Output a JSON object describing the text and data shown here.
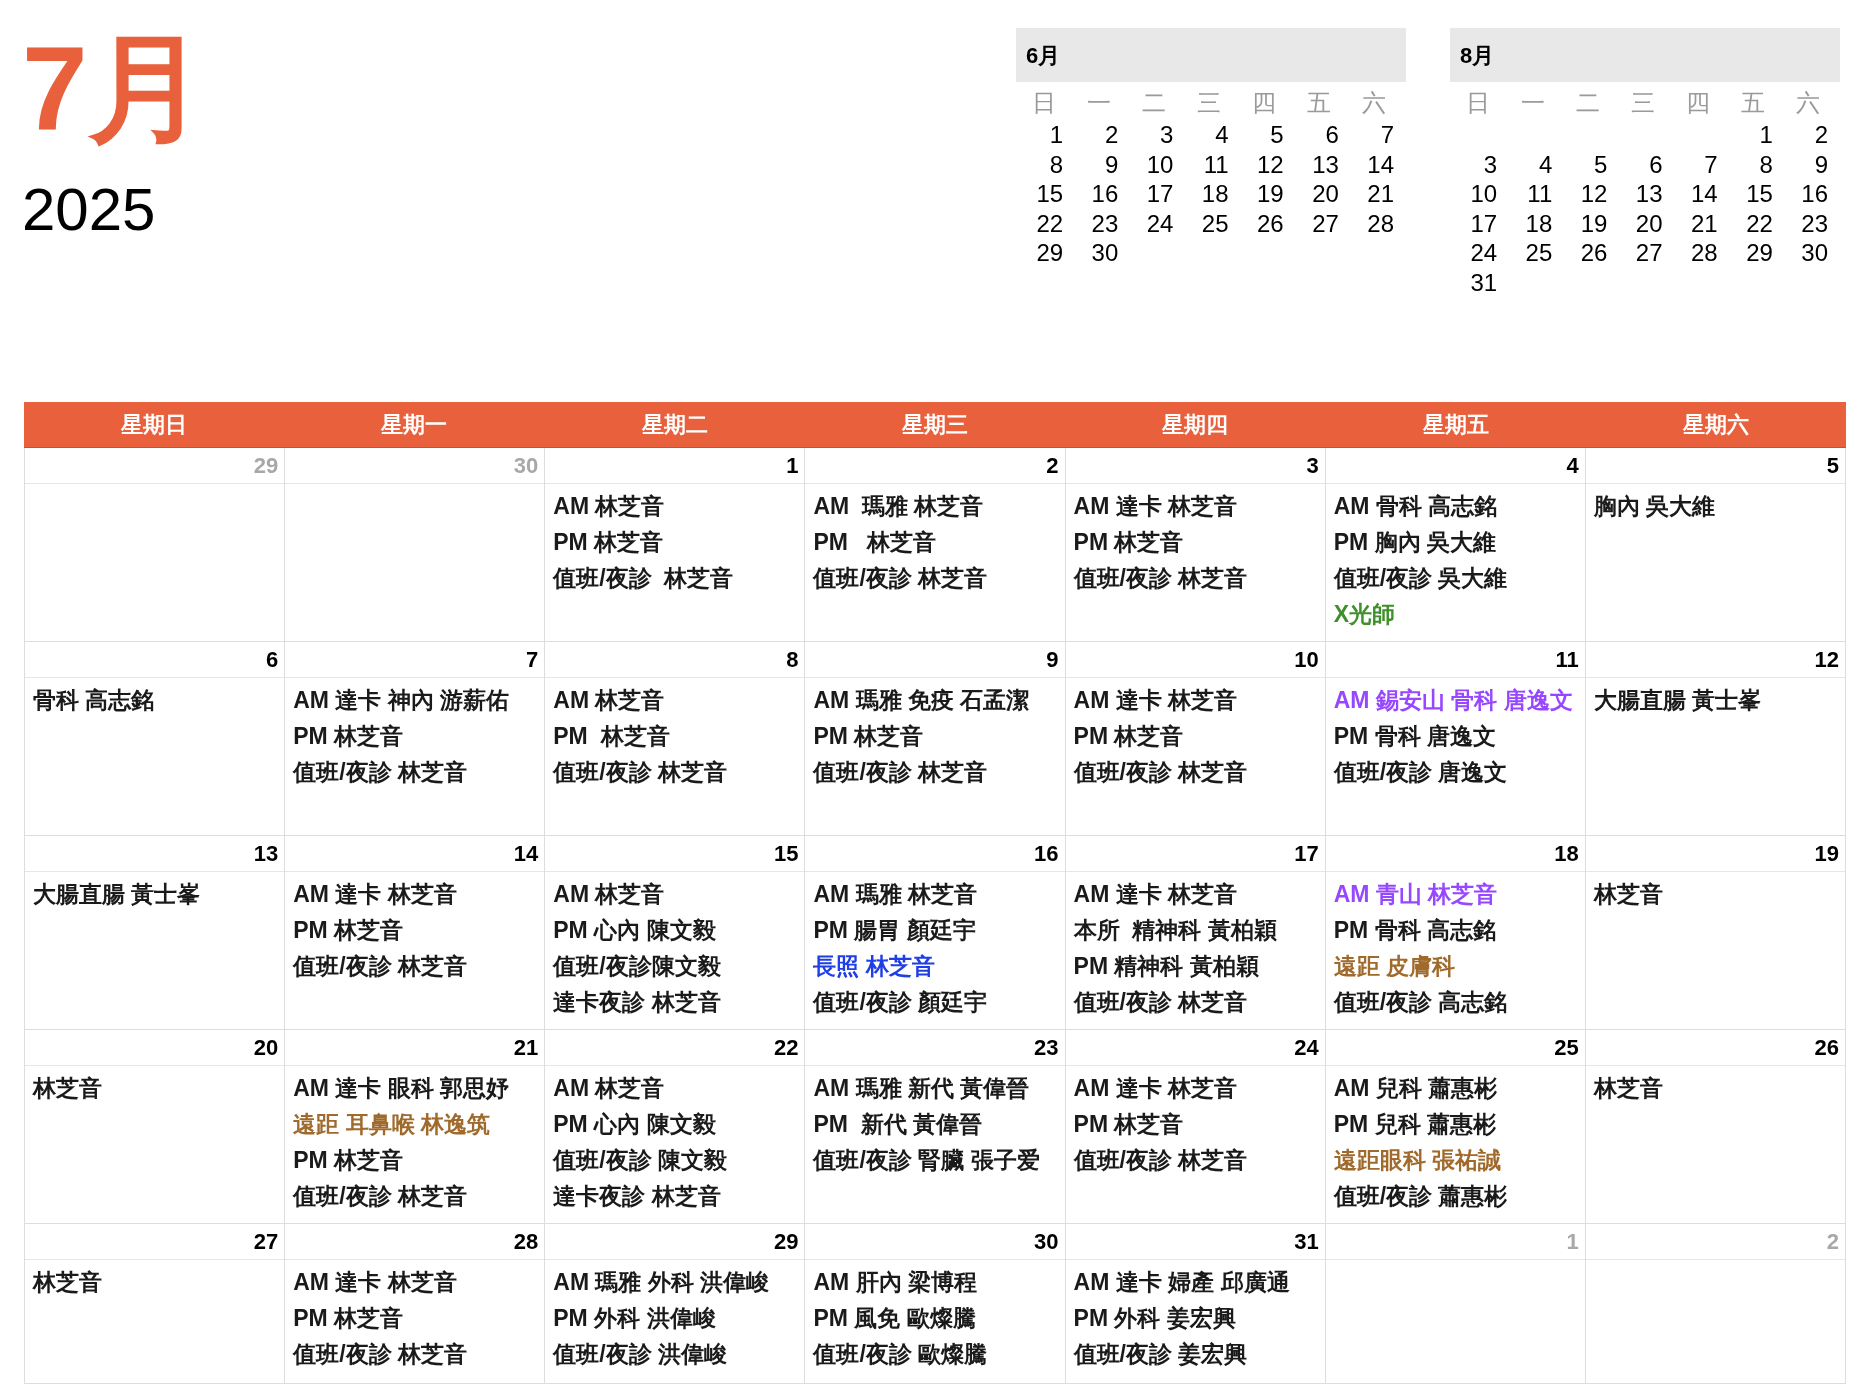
{
  "title": {
    "month": "7月",
    "year": "2025"
  },
  "mini_calendars": [
    {
      "title": "6月",
      "weekdays": [
        "日",
        "一",
        "二",
        "三",
        "四",
        "五",
        "六"
      ],
      "weeks": [
        [
          "1",
          "2",
          "3",
          "4",
          "5",
          "6",
          "7"
        ],
        [
          "8",
          "9",
          "10",
          "11",
          "12",
          "13",
          "14"
        ],
        [
          "15",
          "16",
          "17",
          "18",
          "19",
          "20",
          "21"
        ],
        [
          "22",
          "23",
          "24",
          "25",
          "26",
          "27",
          "28"
        ],
        {
          "right_aligned": false,
          "days": [
            "29",
            "30"
          ]
        }
      ]
    },
    {
      "title": "8月",
      "weekdays": [
        "日",
        "一",
        "二",
        "三",
        "四",
        "五",
        "六"
      ],
      "weeks": [
        {
          "right_aligned": true,
          "days": [
            "1",
            "2"
          ]
        },
        [
          "3",
          "4",
          "5",
          "6",
          "7",
          "8",
          "9"
        ],
        [
          "10",
          "11",
          "12",
          "13",
          "14",
          "15",
          "16"
        ],
        [
          "17",
          "18",
          "19",
          "20",
          "21",
          "22",
          "23"
        ],
        [
          "24",
          "25",
          "26",
          "27",
          "28",
          "29",
          "30"
        ],
        {
          "right_aligned": false,
          "days": [
            "31"
          ]
        }
      ]
    }
  ],
  "calendar": {
    "weekdays": [
      "星期日",
      "星期一",
      "星期二",
      "星期三",
      "星期四",
      "星期五",
      "星期六"
    ],
    "weeks": [
      [
        {
          "date": "29",
          "in_month": false
        },
        {
          "date": "30",
          "in_month": false
        },
        {
          "date": "1",
          "in_month": true,
          "lines": [
            {
              "text": "AM 林芝音"
            },
            {
              "text": "PM 林芝音"
            },
            {
              "text": "值班/夜診  林芝音"
            }
          ]
        },
        {
          "date": "2",
          "in_month": true,
          "lines": [
            {
              "text": "AM  瑪雅 林芝音"
            },
            {
              "text": "PM   林芝音"
            },
            {
              "text": "值班/夜診 林芝音"
            }
          ]
        },
        {
          "date": "3",
          "in_month": true,
          "lines": [
            {
              "text": "AM 達卡 林芝音"
            },
            {
              "text": "PM 林芝音"
            },
            {
              "text": "值班/夜診 林芝音"
            }
          ]
        },
        {
          "date": "4",
          "in_month": true,
          "lines": [
            {
              "text": "AM 骨科 高志銘"
            },
            {
              "text": "PM 胸內 吳大維"
            },
            {
              "text": "值班/夜診 吳大維"
            },
            {
              "text": "X光師",
              "color": "#3f8f2a"
            }
          ]
        },
        {
          "date": "5",
          "in_month": true,
          "lines": [
            {
              "text": "胸內 吳大維"
            }
          ]
        }
      ],
      [
        {
          "date": "6",
          "in_month": true,
          "lines": [
            {
              "text": "骨科 高志銘"
            }
          ]
        },
        {
          "date": "7",
          "in_month": true,
          "lines": [
            {
              "text": "AM 達卡 神內 游薪佑"
            },
            {
              "text": "PM 林芝音"
            },
            {
              "text": "值班/夜診 林芝音"
            }
          ]
        },
        {
          "date": "8",
          "in_month": true,
          "lines": [
            {
              "text": "AM 林芝音"
            },
            {
              "text": "PM  林芝音"
            },
            {
              "text": "值班/夜診 林芝音"
            }
          ]
        },
        {
          "date": "9",
          "in_month": true,
          "lines": [
            {
              "text": "AM 瑪雅 免疫 石孟潔"
            },
            {
              "text": "PM 林芝音"
            },
            {
              "text": "值班/夜診 林芝音"
            }
          ]
        },
        {
          "date": "10",
          "in_month": true,
          "lines": [
            {
              "text": "AM 達卡 林芝音"
            },
            {
              "text": "PM 林芝音"
            },
            {
              "text": "值班/夜診 林芝音"
            }
          ]
        },
        {
          "date": "11",
          "in_month": true,
          "lines": [
            {
              "text": "AM 錫安山 骨科 唐逸文",
              "color": "#9747ff"
            },
            {
              "text": "PM 骨科 唐逸文"
            },
            {
              "text": "值班/夜診 唐逸文"
            }
          ]
        },
        {
          "date": "12",
          "in_month": true,
          "lines": [
            {
              "text": "大腸直腸 黃士峯"
            }
          ]
        }
      ],
      [
        {
          "date": "13",
          "in_month": true,
          "lines": [
            {
              "text": "大腸直腸 黃士峯"
            }
          ]
        },
        {
          "date": "14",
          "in_month": true,
          "lines": [
            {
              "text": "AM 達卡 林芝音"
            },
            {
              "text": "PM 林芝音"
            },
            {
              "text": "值班/夜診 林芝音"
            }
          ]
        },
        {
          "date": "15",
          "in_month": true,
          "lines": [
            {
              "text": "AM 林芝音"
            },
            {
              "text": "PM 心內 陳文毅"
            },
            {
              "text": "值班/夜診陳文毅"
            },
            {
              "text": "達卡夜診 林芝音"
            }
          ]
        },
        {
          "date": "16",
          "in_month": true,
          "lines": [
            {
              "text": "AM 瑪雅 林芝音"
            },
            {
              "text": "PM 腸胃 顏廷宇"
            },
            {
              "text": "長照 林芝音",
              "color": "#1f3fe6"
            },
            {
              "text": "值班/夜診 顏廷宇"
            }
          ]
        },
        {
          "date": "17",
          "in_month": true,
          "lines": [
            {
              "text": "AM 達卡 林芝音"
            },
            {
              "text": "本所  精神科 黃柏穎"
            },
            {
              "text": "PM 精神科 黃柏穎"
            },
            {
              "text": "值班/夜診 林芝音"
            }
          ]
        },
        {
          "date": "18",
          "in_month": true,
          "lines": [
            {
              "text": "AM 青山 林芝音",
              "color": "#9747ff"
            },
            {
              "text": "PM 骨科 高志銘"
            },
            {
              "text": "遠距 皮膚科",
              "color": "#a06a2c"
            },
            {
              "text": "值班/夜診 高志銘"
            }
          ]
        },
        {
          "date": "19",
          "in_month": true,
          "lines": [
            {
              "text": "林芝音"
            }
          ]
        }
      ],
      [
        {
          "date": "20",
          "in_month": true,
          "lines": [
            {
              "text": "林芝音"
            }
          ]
        },
        {
          "date": "21",
          "in_month": true,
          "lines": [
            {
              "text": "AM 達卡 眼科 郭思妤"
            },
            {
              "text": "遠距 耳鼻喉 林逸筑",
              "color": "#a06a2c"
            },
            {
              "text": "PM 林芝音"
            },
            {
              "text": "值班/夜診 林芝音"
            }
          ]
        },
        {
          "date": "22",
          "in_month": true,
          "lines": [
            {
              "text": "AM 林芝音"
            },
            {
              "text": "PM 心內 陳文毅"
            },
            {
              "text": "值班/夜診 陳文毅"
            },
            {
              "text": "達卡夜診 林芝音"
            }
          ]
        },
        {
          "date": "23",
          "in_month": true,
          "lines": [
            {
              "text": "AM 瑪雅 新代 黃偉晉"
            },
            {
              "text": "PM  新代 黃偉晉"
            },
            {
              "text": "值班/夜診 腎臟 張子爱"
            }
          ]
        },
        {
          "date": "24",
          "in_month": true,
          "lines": [
            {
              "text": "AM 達卡 林芝音"
            },
            {
              "text": "PM 林芝音"
            },
            {
              "text": "值班/夜診 林芝音"
            }
          ]
        },
        {
          "date": "25",
          "in_month": true,
          "lines": [
            {
              "text": "AM 兒科 蕭惠彬"
            },
            {
              "text": "PM 兒科 蕭惠彬"
            },
            {
              "text": "遠距眼科 張祐誠",
              "color": "#a06a2c"
            },
            {
              "text": "值班/夜診 蕭惠彬"
            }
          ]
        },
        {
          "date": "26",
          "in_month": true,
          "lines": [
            {
              "text": "林芝音"
            }
          ]
        }
      ],
      [
        {
          "date": "27",
          "in_month": true,
          "lines": [
            {
              "text": "林芝音"
            }
          ]
        },
        {
          "date": "28",
          "in_month": true,
          "lines": [
            {
              "text": "AM 達卡 林芝音"
            },
            {
              "text": "PM 林芝音"
            },
            {
              "text": "值班/夜診 林芝音"
            }
          ]
        },
        {
          "date": "29",
          "in_month": true,
          "lines": [
            {
              "text": "AM 瑪雅 外科 洪偉峻"
            },
            {
              "text": "PM 外科 洪偉峻"
            },
            {
              "text": "值班/夜診 洪偉峻"
            }
          ]
        },
        {
          "date": "30",
          "in_month": true,
          "lines": [
            {
              "text": "AM 肝內 梁博程"
            },
            {
              "text": "PM 風免 歐燦騰"
            },
            {
              "text": "值班/夜診 歐燦騰"
            }
          ]
        },
        {
          "date": "31",
          "in_month": true,
          "lines": [
            {
              "text": "AM 達卡 婦產 邱廣通"
            },
            {
              "text": "PM 外科 姜宏興"
            },
            {
              "text": "值班/夜診 姜宏興"
            }
          ]
        },
        {
          "date": "1",
          "in_month": false
        },
        {
          "date": "2",
          "in_month": false
        }
      ]
    ]
  }
}
